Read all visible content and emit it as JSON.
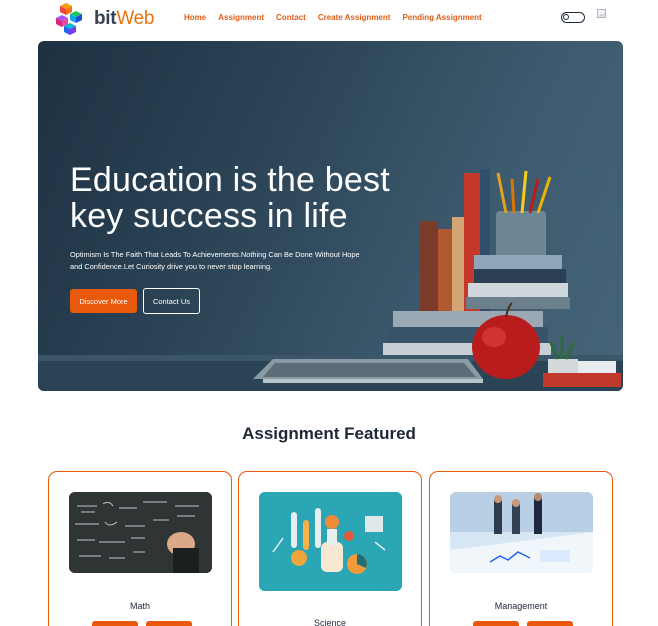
{
  "brand": {
    "name_part1": "bit",
    "name_part2": "Web"
  },
  "nav": {
    "items": [
      "Home",
      "Assignment",
      "Contact",
      "Create Assignment",
      "Pending Assignment"
    ]
  },
  "hero": {
    "title": "Education is the best key success in life",
    "subtitle": "Optimism Is The Faith That Leads To Achievements.Nothing Can Be Done Without Hope and Confidence.Let Curiosity drive you to never stop learning.",
    "primary_button": "Discover More",
    "secondary_button": "Contact Us"
  },
  "featured": {
    "title": "Assignment Featured",
    "cards": [
      {
        "title": "Math",
        "image_icon": "chalkboard-math-icon"
      },
      {
        "title": "Science",
        "image_icon": "science-lab-illustration-icon"
      },
      {
        "title": "Management",
        "image_icon": "business-meeting-icon"
      }
    ]
  },
  "colors": {
    "accent": "#e8590c",
    "hero_bg": "#2c4557",
    "text": "#1f2937"
  }
}
